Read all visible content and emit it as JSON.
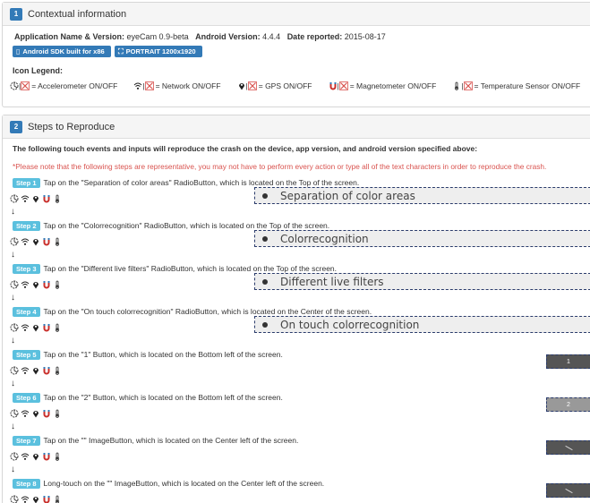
{
  "panel1": {
    "number": "1",
    "title": "Contextual information",
    "app_label": "Application Name & Version:",
    "app_value": "eyeCam 0.9-beta",
    "android_label": "Android Version:",
    "android_value": "4.4.4",
    "date_label": "Date reported:",
    "date_value": "2015-08-17",
    "device_tag": "Android SDK built for x86",
    "orientation_tag": "PORTRAIT 1200x1920",
    "legend_title": "Icon Legend:",
    "legend": [
      {
        "text": "= Accelerometer ON/OFF",
        "icon": "accelerometer-icon"
      },
      {
        "text": "= Network ON/OFF",
        "icon": "network-icon"
      },
      {
        "text": "= GPS ON/OFF",
        "icon": "gps-icon"
      },
      {
        "text": "= Magnetometer ON/OFF",
        "icon": "magnetometer-icon"
      },
      {
        "text": "= Temperature Sensor ON/OFF",
        "icon": "thermometer-icon"
      }
    ]
  },
  "panel2": {
    "number": "2",
    "title": "Steps to Reproduce",
    "intro": "The following touch events and inputs will reproduce the crash on the device, app version, and android version specified above:",
    "note": "*Please note that the following steps are representative, you may not have to perform every action or type all of the text characters in order to reproduce the crash.",
    "steps": [
      {
        "badge": "Step 1",
        "text": "Tap on the \"Separation of color areas\" RadioButton, which is located on the Top of the screen.",
        "widget": "Separation of color areas"
      },
      {
        "badge": "Step 2",
        "text": "Tap on the \"Colorrecognition\" RadioButton, which is located on the Top of the screen.",
        "widget": "Colorrecognition"
      },
      {
        "badge": "Step 3",
        "text": "Tap on the \"Different live filters\" RadioButton, which is located on the Top of the screen.",
        "widget": "Different live filters"
      },
      {
        "badge": "Step 4",
        "text": "Tap on the \"On touch colorrecognition\" RadioButton, which is located on the Center of the screen.",
        "widget": "On touch colorrecognition"
      },
      {
        "badge": "Step 5",
        "text": "Tap on the \"1\" Button, which is located on the Bottom left of the screen.",
        "widget": "1"
      },
      {
        "badge": "Step 6",
        "text": "Tap on the \"2\" Button, which is located on the Bottom left of the screen.",
        "widget": "2"
      },
      {
        "badge": "Step 7",
        "text": "Tap on the \"\" ImageButton, which is located on the Center left of the screen.",
        "widget": ""
      },
      {
        "badge": "Step 8",
        "text": "Long-touch on the \"\" ImageButton, which is located on the Center left of the screen.",
        "widget": ""
      }
    ]
  },
  "colors": {
    "primary": "#337ab7",
    "step": "#5bc0de",
    "note": "#d9534f",
    "button_dark": "#555555",
    "button_light": "#999999"
  }
}
